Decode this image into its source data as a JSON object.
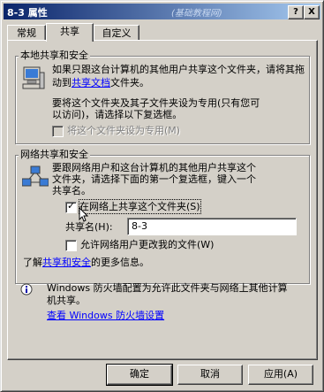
{
  "window": {
    "title": "8-3 属性",
    "watermark": "(基础教程网)",
    "help_button": "?",
    "close_button": "X"
  },
  "tabs": [
    {
      "label": "常规",
      "active": false
    },
    {
      "label": "共享",
      "active": true
    },
    {
      "label": "自定义",
      "active": false
    }
  ],
  "local_sharing": {
    "group_title": "本地共享和安全",
    "desc_part1": "如果只跟这台计算机的其他用户共享这个文件夹",
    "desc_part2": "，请将其拖动到",
    "desc_link": "共享文档",
    "desc_part3": "文件夹。",
    "private_line1": "要将这个文件夹及其子文件夹设为专用(只有您可",
    "private_line2": "以访问)，请选择以下复选框。",
    "private_checkbox_label": "将这个文件夹设为专用(M)",
    "private_checked": false
  },
  "network_sharing": {
    "group_title": "网络共享和安全",
    "desc_line1": "要跟网络用户和这台计算机的其他用户共享这个",
    "desc_line2": "文件夹，请选择下面的第一个复选框，键入一个",
    "desc_line3": "共享名。",
    "share_checkbox_label": "在网络上共享这个文件夹(S)",
    "share_checked": true,
    "share_name_label": "共享名(H):",
    "share_name_value": "8-3",
    "allow_change_label": "允许网络用户更改我的文件(W)",
    "allow_change_checked": false,
    "learn_more_prefix": "了解",
    "learn_more_link": "共享和安全",
    "learn_more_suffix": "的更多信息。"
  },
  "firewall": {
    "info_line1": "Windows 防火墙配置为允许此文件夹与网络上其他计算",
    "info_line2": "机共享。",
    "view_link": "查看 Windows 防火墙设置"
  },
  "buttons": {
    "ok": "确定",
    "cancel": "取消",
    "apply": "应用(A)"
  },
  "colors": {
    "title_start": "#0a246a",
    "title_end": "#a6caf0",
    "face": "#d4d0c8",
    "link": "#0000ff"
  }
}
